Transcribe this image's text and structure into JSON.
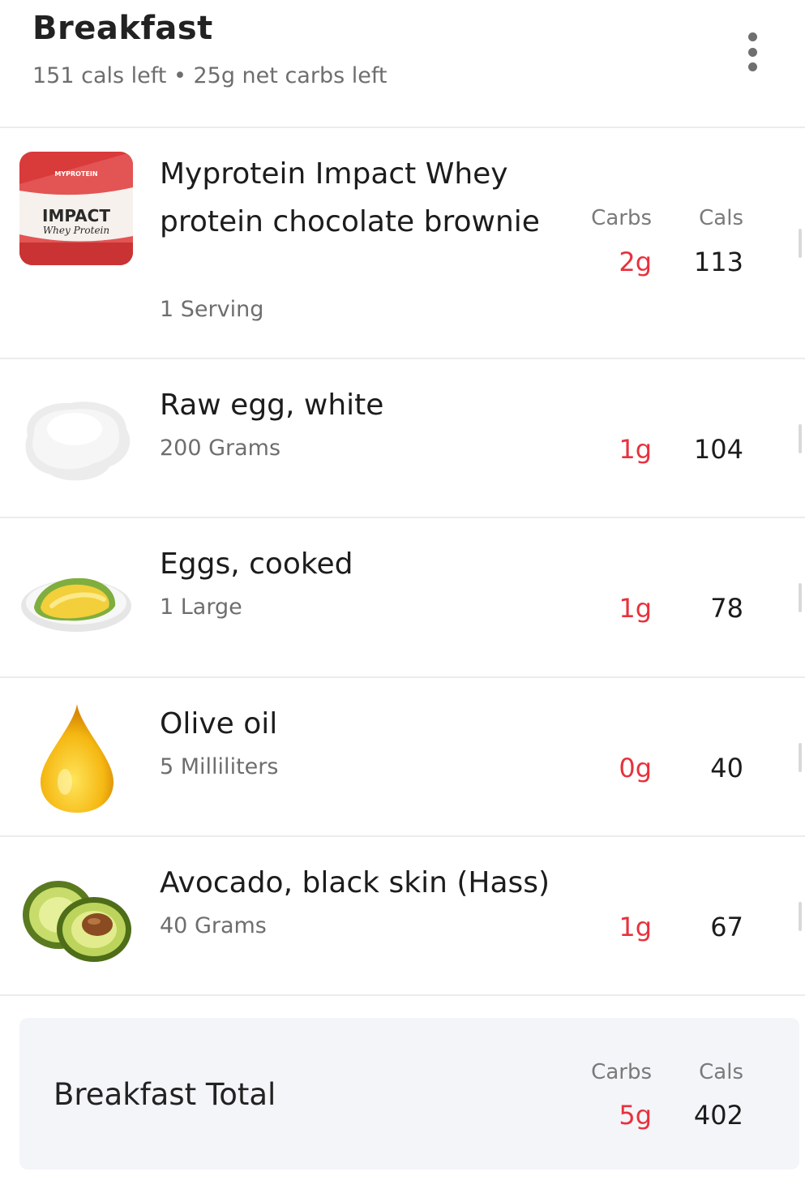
{
  "meal": {
    "title": "Breakfast",
    "subtitle": "151 cals left • 25g net carbs left",
    "more_icon": "more-vertical-icon"
  },
  "columns": {
    "carbs_label": "Carbs",
    "cals_label": "Cals"
  },
  "colors": {
    "carbs": "#e8313c",
    "total_bg": "#f4f5f9"
  },
  "items": [
    {
      "name": "Myprotein Impact Whey protein chocolate brownie",
      "amount": "1 Serving",
      "carbs": "2g",
      "cals": "113",
      "image": "protein-pack-image",
      "pack": {
        "brand": "MYPROTEIN",
        "line1": "IMPACT",
        "line2": "Whey Protein"
      }
    },
    {
      "name": "Raw egg, white",
      "amount": "200 Grams",
      "carbs": "1g",
      "cals": "104",
      "image": "egg-white-image"
    },
    {
      "name": "Eggs, cooked",
      "amount": "1 Large",
      "carbs": "1g",
      "cals": "78",
      "image": "omelette-image"
    },
    {
      "name": "Olive oil",
      "amount": "5 Milliliters",
      "carbs": "0g",
      "cals": "40",
      "image": "oil-drop-image"
    },
    {
      "name": "Avocado, black skin (Hass)",
      "amount": "40 Grams",
      "carbs": "1g",
      "cals": "67",
      "image": "avocado-image"
    }
  ],
  "total": {
    "label": "Breakfast Total",
    "carbs": "5g",
    "cals": "402"
  }
}
